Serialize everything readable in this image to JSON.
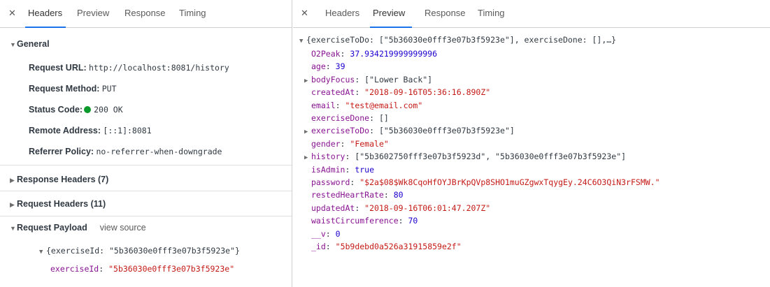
{
  "left": {
    "tabs": [
      "Headers",
      "Preview",
      "Response",
      "Timing"
    ],
    "active_tab": "Headers",
    "general": {
      "title": "General",
      "items": [
        {
          "label": "Request URL:",
          "value": "http://localhost:8081/history"
        },
        {
          "label": "Request Method:",
          "value": "PUT"
        },
        {
          "label": "Status Code:",
          "value": "200 OK"
        },
        {
          "label": "Remote Address:",
          "value": "[::1]:8081"
        },
        {
          "label": "Referrer Policy:",
          "value": "no-referrer-when-downgrade"
        }
      ]
    },
    "response_headers": "Response Headers (7)",
    "request_headers": "Request Headers (11)",
    "payload": {
      "title": "Request Payload",
      "view_source": "view source",
      "summary": "{exerciseId: \"5b36030e0fff3e07b3f5923e\"}",
      "key": "exerciseId",
      "value": "\"5b36030e0fff3e07b3f5923e\""
    },
    "status_color": "#0c9a2c"
  },
  "right": {
    "tabs": [
      "Headers",
      "Preview",
      "Response",
      "Timing"
    ],
    "active_tab": "Preview",
    "summary": "{exerciseToDo: [\"5b36030e0fff3e07b3f5923e\"], exerciseDone: [],…}",
    "fields": [
      {
        "key": "O2Peak",
        "value": "37.934219999999996",
        "type": "num",
        "expandable": false
      },
      {
        "key": "age",
        "value": "39",
        "type": "num",
        "expandable": false
      },
      {
        "key": "bodyFocus",
        "value": "[\"Lower Back\"]",
        "type": "plain",
        "expandable": true
      },
      {
        "key": "createdAt",
        "value": "\"2018-09-16T05:36:16.890Z\"",
        "type": "str",
        "expandable": false
      },
      {
        "key": "email",
        "value": "\"test@email.com\"",
        "type": "str",
        "expandable": false
      },
      {
        "key": "exerciseDone",
        "value": "[]",
        "type": "plain",
        "expandable": false
      },
      {
        "key": "exerciseToDo",
        "value": "[\"5b36030e0fff3e07b3f5923e\"]",
        "type": "plain",
        "expandable": true
      },
      {
        "key": "gender",
        "value": "\"Female\"",
        "type": "str",
        "expandable": false
      },
      {
        "key": "history",
        "value": "[\"5b3602750fff3e07b3f5923d\", \"5b36030e0fff3e07b3f5923e\"]",
        "type": "plain",
        "expandable": true
      },
      {
        "key": "isAdmin",
        "value": "true",
        "type": "num",
        "expandable": false
      },
      {
        "key": "password",
        "value": "\"$2a$08$Wk8CqoHfOYJBrKpQVp8SHO1muGZgwxTqygEy.24C6O3QiN3rFSMW.\"",
        "type": "str",
        "expandable": false
      },
      {
        "key": "restedHeartRate",
        "value": "80",
        "type": "num",
        "expandable": false
      },
      {
        "key": "updatedAt",
        "value": "\"2018-09-16T06:01:47.207Z\"",
        "type": "str",
        "expandable": false
      },
      {
        "key": "waistCircumference",
        "value": "70",
        "type": "num",
        "expandable": false
      },
      {
        "key": "__v",
        "value": "0",
        "type": "num",
        "expandable": false
      },
      {
        "key": "_id",
        "value": "\"5b9debd0a526a31915859e2f\"",
        "type": "str",
        "expandable": false
      }
    ]
  },
  "colors": {
    "key": "#881391",
    "number": "#1c00cf",
    "string": "#c41a16",
    "active_tab_underline": "#1a73e8"
  },
  "icons": {
    "close": "close-icon",
    "expanded": "triangle-down-icon",
    "collapsed": "triangle-right-icon"
  }
}
